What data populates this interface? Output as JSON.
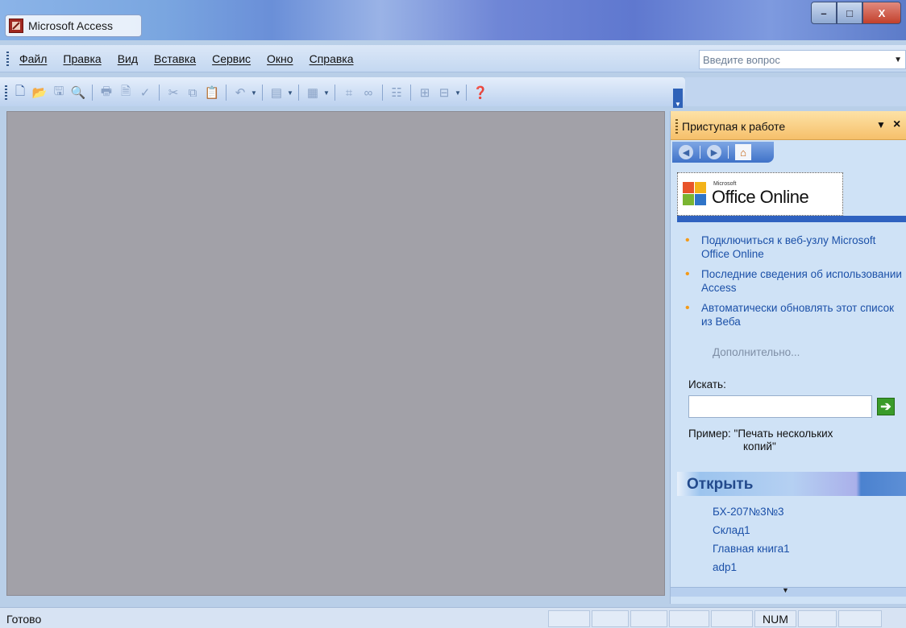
{
  "window": {
    "title": "Microsoft Access",
    "controls": {
      "minimize": "–",
      "maximize": "□",
      "close": "X"
    }
  },
  "menu": {
    "items": [
      "Файл",
      "Правка",
      "Вид",
      "Вставка",
      "Сервис",
      "Окно",
      "Справка"
    ],
    "ask_placeholder": "Введите вопрос"
  },
  "toolbar": {
    "buttons": [
      "new-icon",
      "open-icon",
      "save-icon",
      "file-search-icon",
      "print-icon",
      "print-preview-icon",
      "spelling-icon",
      "cut-icon",
      "copy-icon",
      "paste-icon",
      "undo-icon",
      "office-links-icon",
      "analyze-icon",
      "code-icon",
      "relationships-icon",
      "properties-icon",
      "new-object-icon",
      "help-icon"
    ]
  },
  "task_pane": {
    "title": "Приступая к работе",
    "nav": {
      "back": "back-icon",
      "forward": "forward-icon",
      "home": "home-icon"
    },
    "logo": {
      "brand_small": "Microsoft",
      "brand": "Office Online"
    },
    "links": [
      "Подключиться к веб-узлу Microsoft Office Online",
      "Последние сведения об использовании Access",
      "Автоматически обновлять этот список из Веба"
    ],
    "more": "Дополнительно...",
    "search": {
      "label": "Искать:",
      "value": "",
      "example_line1": "Пример:  \"Печать нескольких",
      "example_line2": "копий\""
    },
    "open": {
      "title": "Открыть",
      "files": [
        "БХ-207№3№3",
        "Склад1",
        "Главная книга1",
        "adp1"
      ]
    }
  },
  "status": {
    "text": "Готово",
    "indicators": [
      "",
      "",
      "",
      "",
      "",
      "NUM",
      "",
      ""
    ]
  },
  "colors": {
    "workspace": "#a2a1a8",
    "task_pane_header": "#f6c06b",
    "link": "#1b50a8",
    "bullet": "#f49a18"
  }
}
